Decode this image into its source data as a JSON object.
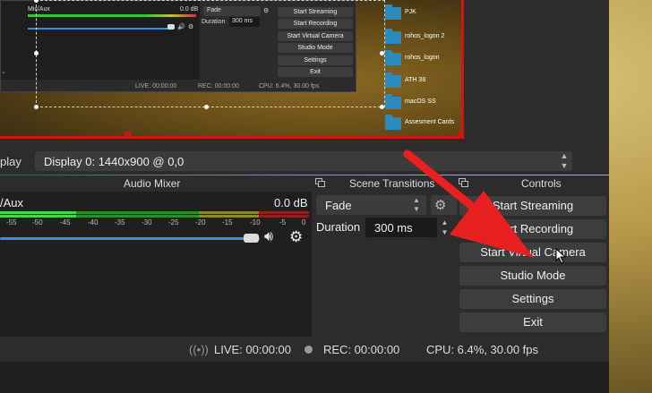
{
  "nested": {
    "mixer_label": "Mic/Aux",
    "mixer_db": "0.0 dB",
    "fade_value": "Fade",
    "duration_label": "Duration",
    "duration_value": "300 ms",
    "buttons": [
      "Start Streaming",
      "Start Recording",
      "Start Virtual Camera",
      "Studio Mode",
      "Settings",
      "Exit"
    ],
    "status_live": "LIVE: 00:00:00",
    "status_rec": "REC: 00:00:00",
    "status_cpu": "CPU: 6.4%, 30.00 fps"
  },
  "folders": [
    "PJK",
    "rohos_logon 2",
    "rohos_logon",
    "ATH 38",
    "macOS SS",
    "Assesment Cards"
  ],
  "display": {
    "label": "play",
    "value": "Display 0: 1440x900 @ 0,0"
  },
  "docks": {
    "audio_mixer": "Audio Mixer",
    "scene_transitions": "Scene Transitions",
    "controls": "Controls"
  },
  "mixer": {
    "channel": "/Aux",
    "db": "0.0 dB",
    "ticks": [
      "-55",
      "-50",
      "-45",
      "-40",
      "-35",
      "-30",
      "-25",
      "-20",
      "-15",
      "-10",
      "-5",
      "0"
    ]
  },
  "transitions": {
    "selected": "Fade",
    "duration_label": "Duration",
    "duration_value": "300 ms"
  },
  "controls": {
    "start_streaming": "Start Streaming",
    "start_recording": "Start Recording",
    "start_virtual_camera": "Start Virtual Camera",
    "studio_mode": "Studio Mode",
    "settings": "Settings",
    "exit": "Exit"
  },
  "status": {
    "live": "LIVE: 00:00:00",
    "rec": "REC: 00:00:00",
    "cpu": "CPU: 6.4%, 30.00 fps"
  },
  "colors": {
    "accent_red": "#d01515",
    "fader_blue": "#3a8ee8",
    "folder_blue": "#2a8bbd"
  }
}
